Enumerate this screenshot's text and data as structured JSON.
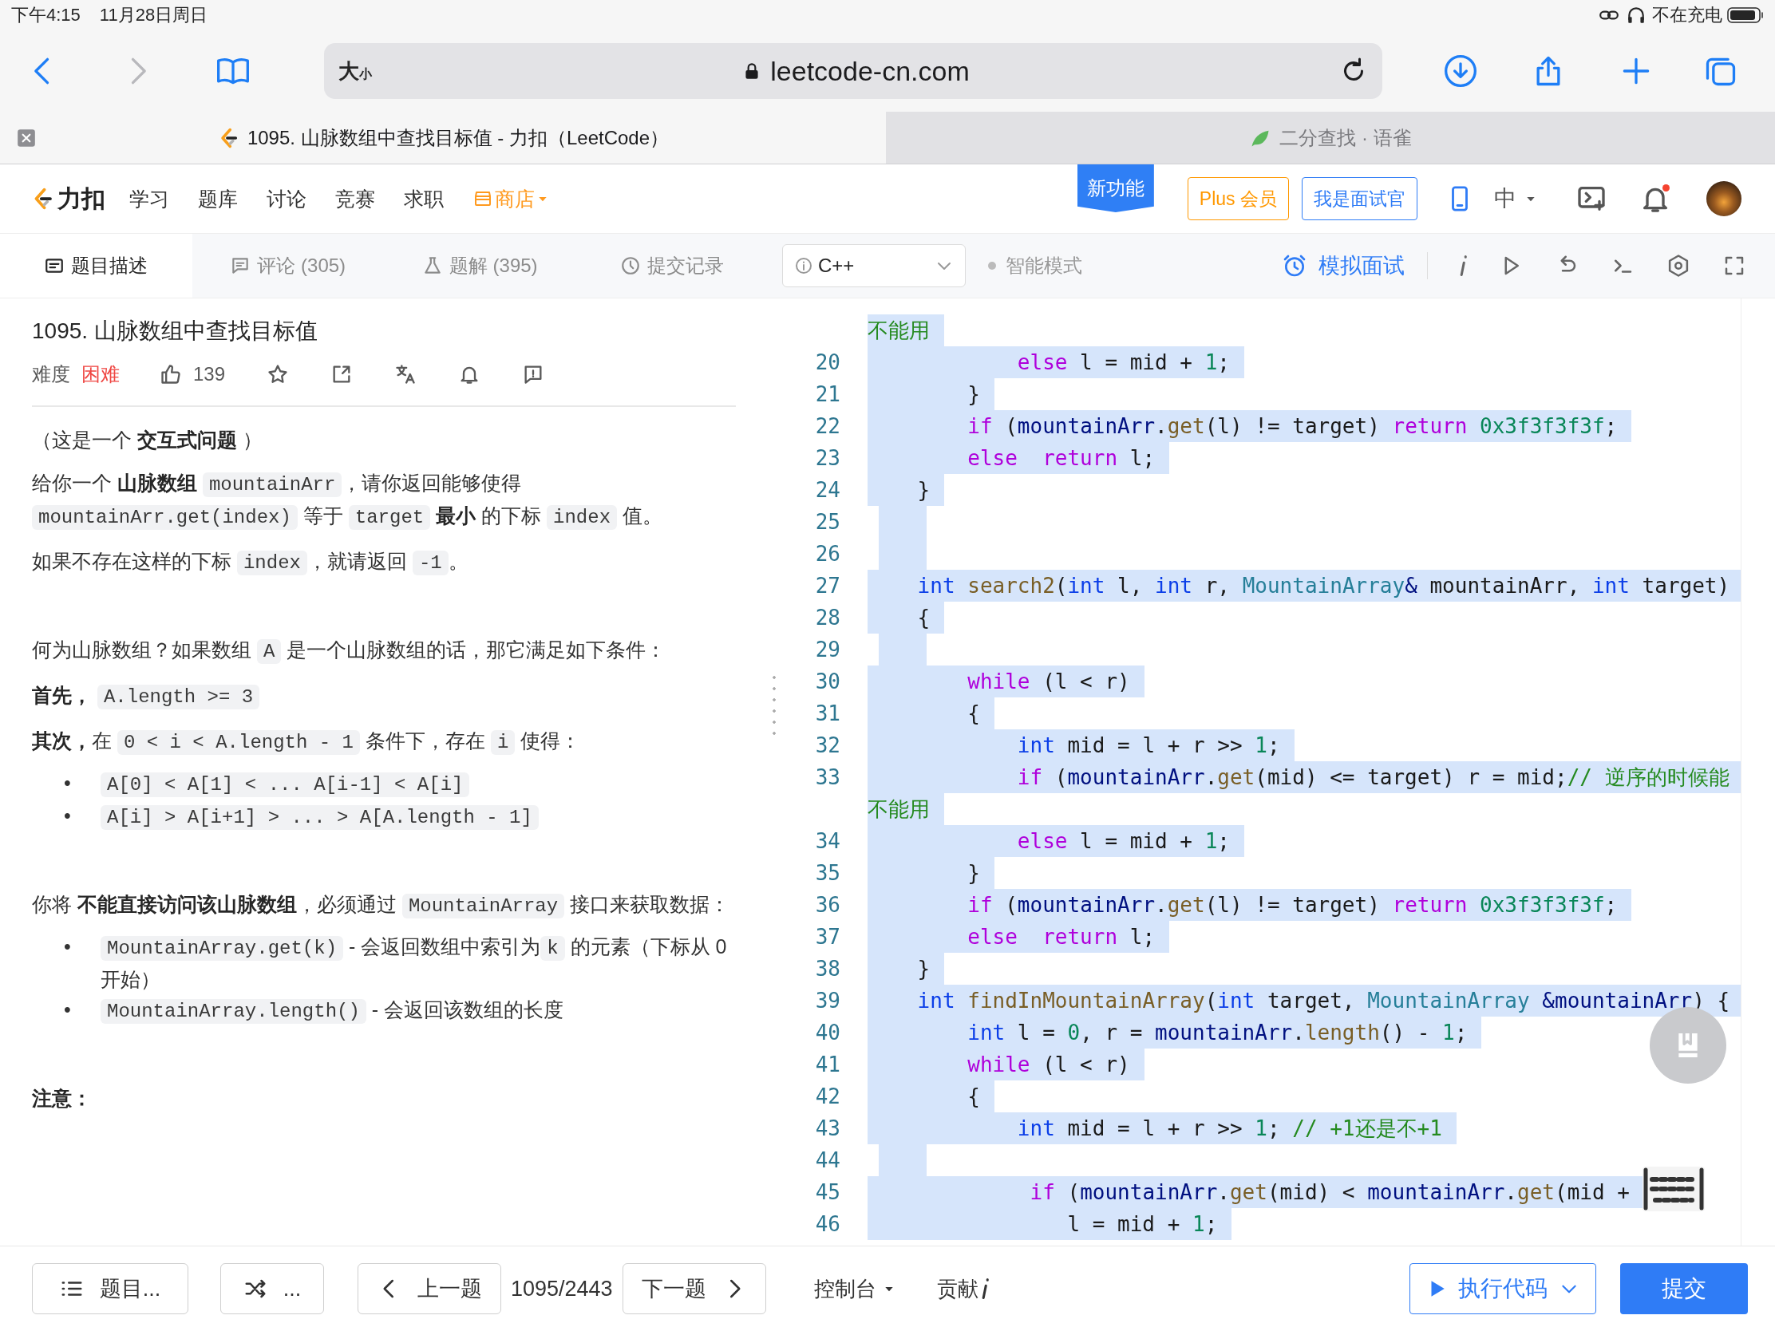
{
  "status_bar": {
    "time": "下午4:15",
    "date": "11月28日周日",
    "charging": "不在充电"
  },
  "browser": {
    "text_size": [
      "大",
      "小"
    ],
    "url": "leetcode-cn.com",
    "tabs": [
      {
        "title": "1095. 山脉数组中查找目标值 - 力扣（LeetCode）",
        "selected": true
      },
      {
        "title": "二分查找 · 语雀",
        "selected": false
      }
    ]
  },
  "nav": {
    "logo": "力扣",
    "items": [
      {
        "label": "学习",
        "kind": "link"
      },
      {
        "label": "题库",
        "kind": "link"
      },
      {
        "label": "讨论",
        "kind": "link"
      },
      {
        "label": "竞赛",
        "kind": "link"
      },
      {
        "label": "求职",
        "kind": "link"
      },
      {
        "label": "商店",
        "kind": "store"
      }
    ],
    "new_feature": "新功能",
    "plus": "Plus 会员",
    "interviewer": "我是面试官",
    "language": "中"
  },
  "toolbar": {
    "tabs": [
      {
        "label": "题目描述",
        "selected": true
      },
      {
        "label": "评论 (305)",
        "selected": false
      },
      {
        "label": "题解 (395)",
        "selected": false
      },
      {
        "label": "提交记录",
        "selected": false
      }
    ],
    "code_language": "C++",
    "mode": "智能模式",
    "mock_interview": "模拟面试"
  },
  "problem": {
    "title": "1095. 山脉数组中查找目标值",
    "difficulty_label": "难度",
    "difficulty": "困难",
    "likes": "139",
    "blocks": [
      {
        "kind": "paragraph",
        "parts": [
          {
            "kind": "text",
            "text": "（这是一个 "
          },
          {
            "kind": "bold",
            "text": "交互式问题"
          },
          {
            "kind": "text",
            "text": " ）"
          }
        ]
      },
      {
        "kind": "paragraph",
        "parts": [
          {
            "kind": "text",
            "text": "给你一个 "
          },
          {
            "kind": "bold",
            "text": "山脉数组 "
          },
          {
            "kind": "code",
            "text": "mountainArr"
          },
          {
            "kind": "text",
            "text": "，请你返回能够使得 "
          },
          {
            "kind": "code",
            "text": "mountainArr.get(index)"
          },
          {
            "kind": "text",
            "text": " 等于 "
          },
          {
            "kind": "code",
            "text": "target"
          },
          {
            "kind": "bold",
            "text": " 最小"
          },
          {
            "kind": "text",
            "text": " 的下标 "
          },
          {
            "kind": "code",
            "text": "index"
          },
          {
            "kind": "text",
            "text": " 值。"
          }
        ]
      },
      {
        "kind": "paragraph",
        "parts": [
          {
            "kind": "text",
            "text": "如果不存在这样的下标 "
          },
          {
            "kind": "code",
            "text": "index"
          },
          {
            "kind": "text",
            "text": "，就请返回 "
          },
          {
            "kind": "code",
            "text": "-1"
          },
          {
            "kind": "text",
            "text": "。"
          }
        ]
      },
      {
        "kind": "blank"
      },
      {
        "kind": "paragraph",
        "parts": [
          {
            "kind": "text",
            "text": "何为山脉数组？如果数组 "
          },
          {
            "kind": "code",
            "text": "A"
          },
          {
            "kind": "text",
            "text": " 是一个山脉数组的话，那它满足如下条件："
          }
        ]
      },
      {
        "kind": "paragraph",
        "parts": [
          {
            "kind": "bold",
            "text": "首先， "
          },
          {
            "kind": "code",
            "text": "A.length >= 3"
          }
        ]
      },
      {
        "kind": "paragraph",
        "parts": [
          {
            "kind": "bold",
            "text": "其次，"
          },
          {
            "kind": "text",
            "text": "在 "
          },
          {
            "kind": "code",
            "text": "0 < i < A.length - 1"
          },
          {
            "kind": "text",
            "text": " 条件下，存在 "
          },
          {
            "kind": "code",
            "text": "i"
          },
          {
            "kind": "text",
            "text": " 使得："
          }
        ]
      },
      {
        "kind": "bullets",
        "items": [
          {
            "marker": "•",
            "parts": [
              {
                "kind": "code",
                "text": "A[0] < A[1] < ... A[i-1] < A[i]"
              }
            ]
          },
          {
            "marker": "•",
            "parts": [
              {
                "kind": "code",
                "text": "A[i] > A[i+1] > ... > A[A.length - 1]"
              }
            ]
          }
        ]
      },
      {
        "kind": "blank"
      },
      {
        "kind": "paragraph",
        "parts": [
          {
            "kind": "text",
            "text": "你将 "
          },
          {
            "kind": "bold",
            "text": "不能直接访问该山脉数组"
          },
          {
            "kind": "text",
            "text": "，必须通过 "
          },
          {
            "kind": "code",
            "text": "MountainArray"
          },
          {
            "kind": "text",
            "text": " 接口来获取数据："
          }
        ]
      },
      {
        "kind": "bullets",
        "items": [
          {
            "marker": "•",
            "parts": [
              {
                "kind": "code",
                "text": "MountainArray.get(k)"
              },
              {
                "kind": "text",
                "text": " - 会返回数组中索引为"
              },
              {
                "kind": "code",
                "text": "k"
              },
              {
                "kind": "text",
                "text": " 的元素（下标从 0 开始）"
              }
            ]
          },
          {
            "marker": "•",
            "parts": [
              {
                "kind": "code",
                "text": "MountainArray.length()"
              },
              {
                "kind": "text",
                "text": " - 会返回该数组的长度"
              }
            ]
          }
        ]
      },
      {
        "kind": "blank"
      },
      {
        "kind": "paragraph",
        "parts": [
          {
            "kind": "bold",
            "text": "注意："
          }
        ]
      }
    ]
  },
  "editor": {
    "lines": [
      {
        "tokens": [
          {
            "kind": "comment",
            "text": "不能用"
          }
        ]
      },
      {
        "number": "20",
        "tokens": [
          {
            "kind": "keyword",
            "text": "            else"
          },
          {
            "kind": "plain",
            "text": " l = mid + "
          },
          {
            "kind": "number",
            "text": "1"
          },
          {
            "kind": "plain",
            "text": ";"
          }
        ]
      },
      {
        "number": "21",
        "tokens": [
          {
            "kind": "plain",
            "text": "        }"
          }
        ]
      },
      {
        "number": "22",
        "tokens": [
          {
            "kind": "keyword",
            "text": "        if"
          },
          {
            "kind": "plain",
            "text": " ("
          },
          {
            "kind": "variable",
            "text": "mountainArr"
          },
          {
            "kind": "plain",
            "text": "."
          },
          {
            "kind": "function",
            "text": "get"
          },
          {
            "kind": "plain",
            "text": "(l) != target) "
          },
          {
            "kind": "keyword",
            "text": "return"
          },
          {
            "kind": "number",
            "text": " 0x3f3f3f3f"
          },
          {
            "kind": "plain",
            "text": ";"
          }
        ]
      },
      {
        "number": "23",
        "tokens": [
          {
            "kind": "keyword",
            "text": "        else"
          },
          {
            "kind": "keyword",
            "text": "  return"
          },
          {
            "kind": "plain",
            "text": " l;"
          }
        ]
      },
      {
        "number": "24",
        "tokens": [
          {
            "kind": "plain",
            "text": "    }"
          }
        ]
      },
      {
        "number": "25"
      },
      {
        "number": "26"
      },
      {
        "number": "27",
        "tokens": [
          {
            "kind": "type",
            "text": "    int"
          },
          {
            "kind": "function",
            "text": " search2"
          },
          {
            "kind": "plain",
            "text": "("
          },
          {
            "kind": "type",
            "text": "int"
          },
          {
            "kind": "plain",
            "text": " l, "
          },
          {
            "kind": "type",
            "text": "int"
          },
          {
            "kind": "plain",
            "text": " r, "
          },
          {
            "kind": "class",
            "text": "MountainArray"
          },
          {
            "kind": "variable",
            "text": "&"
          },
          {
            "kind": "plain",
            "text": " mountainArr, "
          },
          {
            "kind": "type",
            "text": "int"
          },
          {
            "kind": "plain",
            "text": " target)"
          }
        ]
      },
      {
        "number": "28",
        "tokens": [
          {
            "kind": "plain",
            "text": "    {"
          }
        ]
      },
      {
        "number": "29"
      },
      {
        "number": "30",
        "tokens": [
          {
            "kind": "keyword",
            "text": "        while"
          },
          {
            "kind": "plain",
            "text": " (l < r)"
          }
        ]
      },
      {
        "number": "31",
        "tokens": [
          {
            "kind": "plain",
            "text": "        {"
          }
        ]
      },
      {
        "number": "32",
        "tokens": [
          {
            "kind": "type",
            "text": "            int"
          },
          {
            "kind": "plain",
            "text": " mid = l + r >> "
          },
          {
            "kind": "number",
            "text": "1"
          },
          {
            "kind": "plain",
            "text": ";"
          }
        ]
      },
      {
        "number": "33",
        "tokens": [
          {
            "kind": "keyword",
            "text": "            if"
          },
          {
            "kind": "plain",
            "text": " ("
          },
          {
            "kind": "variable",
            "text": "mountainArr"
          },
          {
            "kind": "plain",
            "text": "."
          },
          {
            "kind": "function",
            "text": "get"
          },
          {
            "kind": "plain",
            "text": "(mid) <= target) r = mid;"
          },
          {
            "kind": "comment",
            "text": "// 逆序的时候能"
          }
        ]
      },
      {
        "tokens": [
          {
            "kind": "comment",
            "text": "不能用"
          }
        ]
      },
      {
        "number": "34",
        "tokens": [
          {
            "kind": "keyword",
            "text": "            else"
          },
          {
            "kind": "plain",
            "text": " l = mid + "
          },
          {
            "kind": "number",
            "text": "1"
          },
          {
            "kind": "plain",
            "text": ";"
          }
        ]
      },
      {
        "number": "35",
        "tokens": [
          {
            "kind": "plain",
            "text": "        }"
          }
        ]
      },
      {
        "number": "36",
        "tokens": [
          {
            "kind": "keyword",
            "text": "        if"
          },
          {
            "kind": "plain",
            "text": " ("
          },
          {
            "kind": "variable",
            "text": "mountainArr"
          },
          {
            "kind": "plain",
            "text": "."
          },
          {
            "kind": "function",
            "text": "get"
          },
          {
            "kind": "plain",
            "text": "(l) != target) "
          },
          {
            "kind": "keyword",
            "text": "return"
          },
          {
            "kind": "number",
            "text": " 0x3f3f3f3f"
          },
          {
            "kind": "plain",
            "text": ";"
          }
        ]
      },
      {
        "number": "37",
        "tokens": [
          {
            "kind": "keyword",
            "text": "        else"
          },
          {
            "kind": "keyword",
            "text": "  return"
          },
          {
            "kind": "plain",
            "text": " l;"
          }
        ]
      },
      {
        "number": "38",
        "tokens": [
          {
            "kind": "plain",
            "text": "    }"
          }
        ]
      },
      {
        "number": "39",
        "tokens": [
          {
            "kind": "type",
            "text": "    int"
          },
          {
            "kind": "function",
            "text": " findInMountainArray"
          },
          {
            "kind": "plain",
            "text": "("
          },
          {
            "kind": "type",
            "text": "int"
          },
          {
            "kind": "plain",
            "text": " target, "
          },
          {
            "kind": "class",
            "text": "MountainArray"
          },
          {
            "kind": "variable",
            "text": " &mountainArr"
          },
          {
            "kind": "plain",
            "text": ") {"
          }
        ]
      },
      {
        "number": "40",
        "tokens": [
          {
            "kind": "type",
            "text": "        int"
          },
          {
            "kind": "plain",
            "text": " l = "
          },
          {
            "kind": "number",
            "text": "0"
          },
          {
            "kind": "plain",
            "text": ", r = "
          },
          {
            "kind": "variable",
            "text": "mountainArr"
          },
          {
            "kind": "plain",
            "text": "."
          },
          {
            "kind": "function",
            "text": "length"
          },
          {
            "kind": "plain",
            "text": "() - "
          },
          {
            "kind": "number",
            "text": "1"
          },
          {
            "kind": "plain",
            "text": ";"
          }
        ]
      },
      {
        "number": "41",
        "tokens": [
          {
            "kind": "keyword",
            "text": "        while"
          },
          {
            "kind": "plain",
            "text": " (l < r)"
          }
        ]
      },
      {
        "number": "42",
        "tokens": [
          {
            "kind": "plain",
            "text": "        {"
          }
        ]
      },
      {
        "number": "43",
        "tokens": [
          {
            "kind": "type",
            "text": "            int"
          },
          {
            "kind": "plain",
            "text": " mid = l + r >> "
          },
          {
            "kind": "number",
            "text": "1"
          },
          {
            "kind": "plain",
            "text": "; "
          },
          {
            "kind": "comment",
            "text": "// +1还是不+1"
          }
        ]
      },
      {
        "number": "44"
      },
      {
        "number": "45",
        "tokens": [
          {
            "kind": "keyword",
            "text": "             if"
          },
          {
            "kind": "plain",
            "text": " ("
          },
          {
            "kind": "variable",
            "text": "mountainArr"
          },
          {
            "kind": "plain",
            "text": "."
          },
          {
            "kind": "function",
            "text": "get"
          },
          {
            "kind": "plain",
            "text": "(mid) < "
          },
          {
            "kind": "variable",
            "text": "mountainArr"
          },
          {
            "kind": "plain",
            "text": "."
          },
          {
            "kind": "function",
            "text": "get"
          },
          {
            "kind": "plain",
            "text": "(mid +"
          }
        ]
      },
      {
        "number": "46",
        "tokens": [
          {
            "kind": "plain",
            "text": "                l = mid + "
          },
          {
            "kind": "number",
            "text": "1"
          },
          {
            "kind": "plain",
            "text": ";"
          }
        ]
      }
    ]
  },
  "footer": {
    "list": "题目...",
    "random": "...",
    "prev": "上一题",
    "counter": "1095/2443",
    "next": "下一题",
    "console": "控制台",
    "contribute": "贡献",
    "run": "执行代码",
    "submit": "提交"
  }
}
